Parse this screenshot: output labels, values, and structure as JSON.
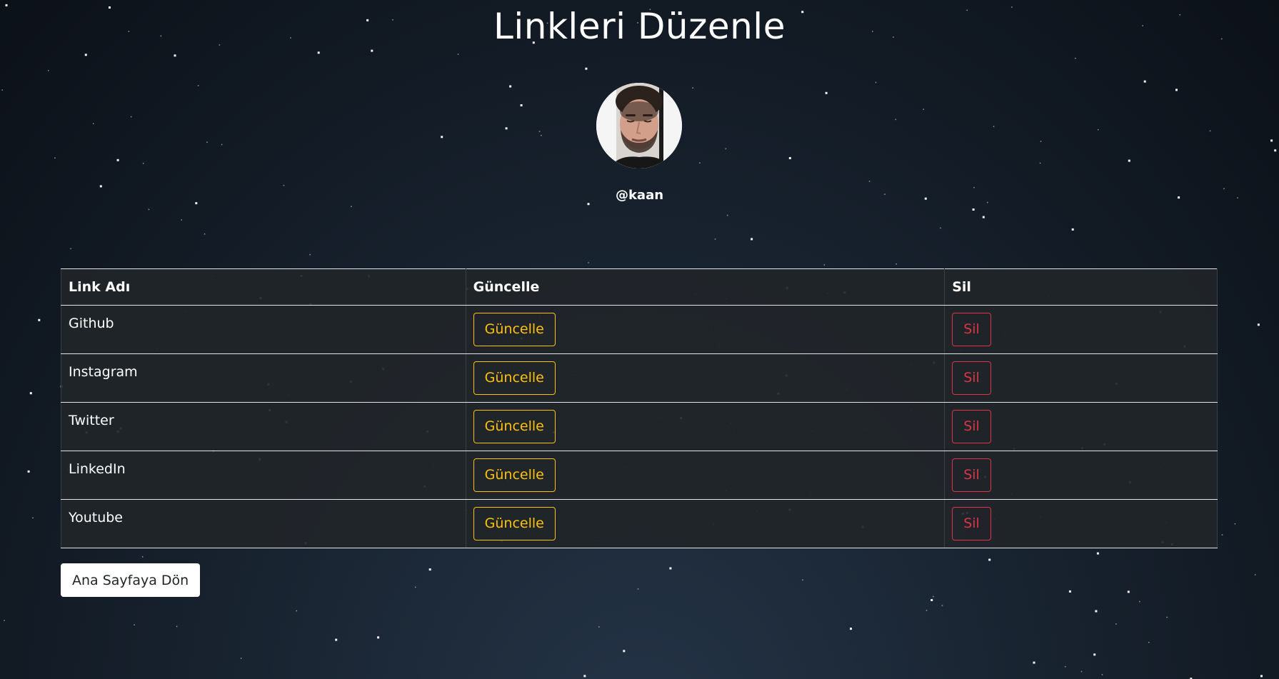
{
  "page": {
    "title": "Linkleri Düzenle"
  },
  "profile": {
    "username": "@kaan",
    "avatar_icon": "user-photo"
  },
  "table": {
    "headers": [
      "Link Adı",
      "Güncelle",
      "Sil"
    ],
    "rows": [
      {
        "name": "Github",
        "update_label": "Güncelle",
        "delete_label": "Sil"
      },
      {
        "name": "Instagram",
        "update_label": "Güncelle",
        "delete_label": "Sil"
      },
      {
        "name": "Twitter",
        "update_label": "Güncelle",
        "delete_label": "Sil"
      },
      {
        "name": "LinkedIn",
        "update_label": "Güncelle",
        "delete_label": "Sil"
      },
      {
        "name": "Youtube",
        "update_label": "Güncelle",
        "delete_label": "Sil"
      }
    ]
  },
  "actions": {
    "back_label": "Ana Sayfaya Dön"
  },
  "colors": {
    "warning": "#ffc107",
    "danger": "#dc3545",
    "table_bg": "#212529",
    "background": "#1b2735"
  }
}
